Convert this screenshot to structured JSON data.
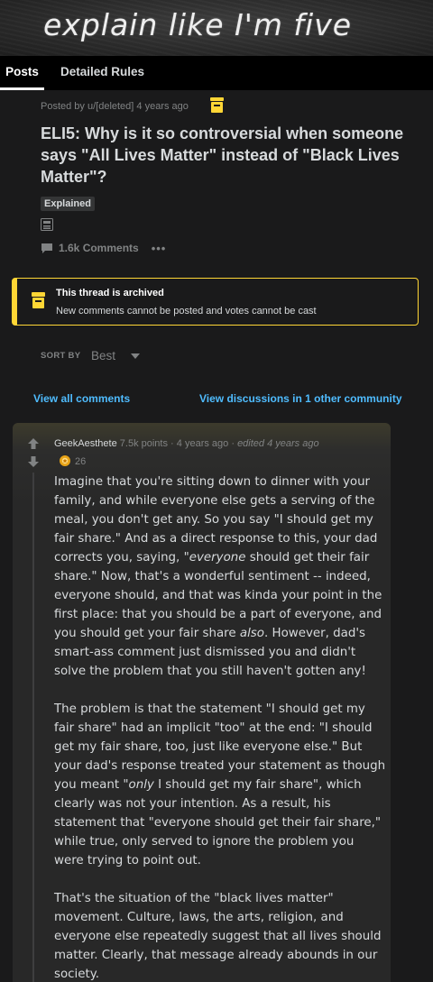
{
  "banner": {
    "title": "explain like I'm five"
  },
  "tabs": {
    "posts": "Posts",
    "rules": "Detailed Rules"
  },
  "post": {
    "meta": "Posted by u/[deleted] 4 years ago",
    "title": "ELI5: Why is it so controversial when someone says \"All Lives Matter\" instead of \"Black Lives Matter\"?",
    "flair": "Explained",
    "comments": "1.6k Comments",
    "more": "•••"
  },
  "archived": {
    "title": "This thread is archived",
    "text": "New comments cannot be posted and votes cannot be cast"
  },
  "sort": {
    "label": "SORT BY",
    "value": "Best"
  },
  "links": {
    "view_all": "View all comments",
    "view_discussions": "View discussions in 1 other community"
  },
  "comment": {
    "author": "GeekAesthete",
    "points": "7.5k points",
    "sep1": "·",
    "age": "4 years ago",
    "sep2": "·",
    "edited": "edited 4 years ago",
    "award_count": "26",
    "p1_a": "Imagine that you're sitting down to dinner with your family, and while everyone else gets a serving of the meal, you don't get any. So you say \"I should get my fair share.\" And as a direct response to this, your dad corrects you, saying, \"",
    "p1_em1": "everyone",
    "p1_b": " should get their fair share.\" Now, that's a wonderful sentiment -- indeed, everyone should, and that was kinda your point in the first place: that you should be a part of everyone, and you should get your fair share ",
    "p1_em2": "also",
    "p1_c": ". However, dad's smart-ass comment just dismissed you and didn't solve the problem that you still haven't gotten any!",
    "p2_a": "The problem is that the statement \"I should get my fair share\" had an implicit \"too\" at the end: \"I should get my fair share, too, just like everyone else.\" But your dad's response treated your statement as though you meant \"",
    "p2_em": "only",
    "p2_b": " I should get my fair share\", which clearly was not your intention. As a result, his statement that \"everyone should get their fair share,\" while true, only served to ignore the problem you were trying to point out.",
    "p3": "That's the situation of the \"black lives matter\" movement. Culture, laws, the arts, religion, and everyone else repeatedly suggest that all lives should matter. Clearly, that message already abounds in our society."
  },
  "colors": {
    "accent": "#4fbcff",
    "archive": "#ffd635",
    "bg": "#1a1a1b",
    "card": "#282828"
  }
}
